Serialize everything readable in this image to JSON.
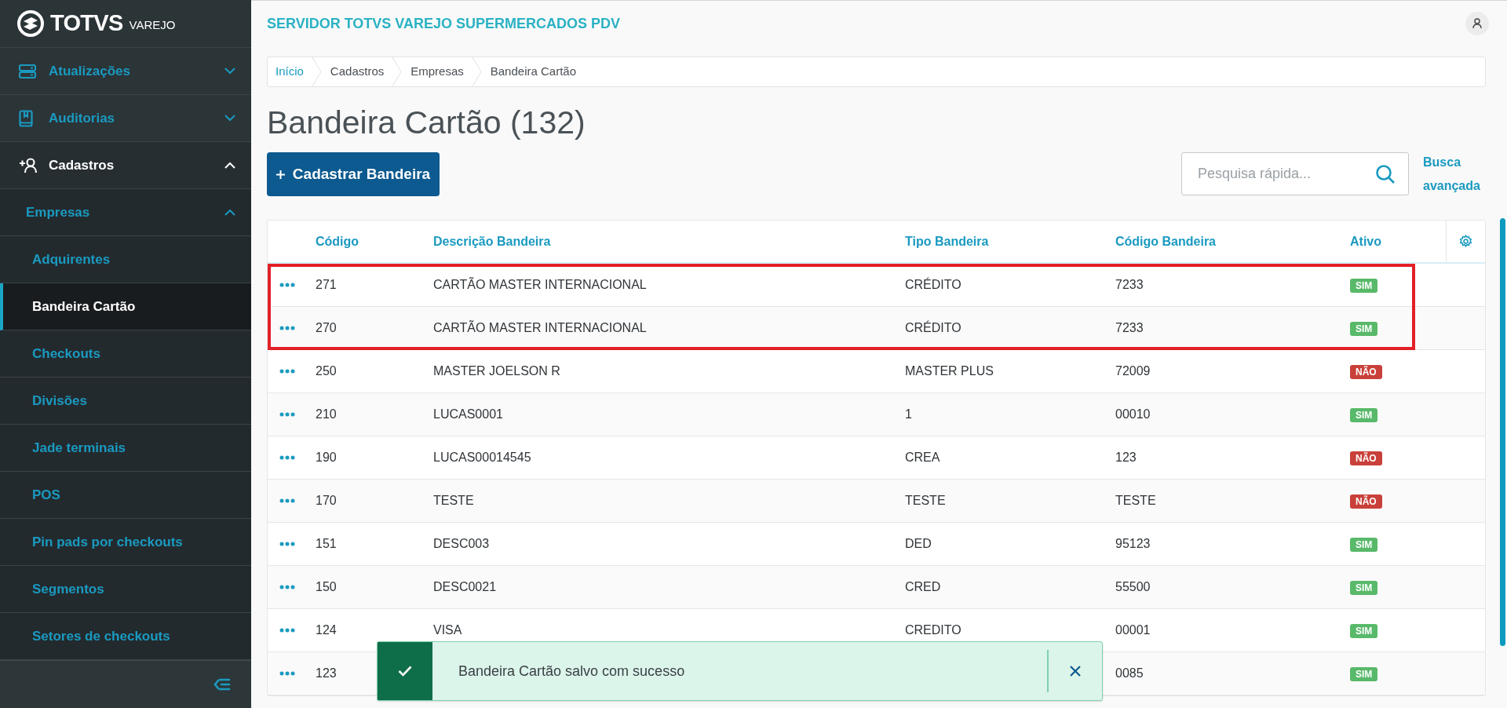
{
  "app": {
    "logo": "TOTVS",
    "logo_sub": "VAREJO",
    "server": "SERVIDOR TOTVS VAREJO SUPERMERCADOS PDV"
  },
  "sidebar": {
    "items": [
      {
        "label": "Atualizações",
        "expanded": false
      },
      {
        "label": "Auditorias",
        "expanded": false
      },
      {
        "label": "Cadastros",
        "expanded": true,
        "children": [
          {
            "label": "Empresas",
            "expanded": true,
            "children": [
              {
                "label": "Adquirentes",
                "selected": false
              },
              {
                "label": "Bandeira Cartão",
                "selected": true
              },
              {
                "label": "Checkouts",
                "selected": false
              },
              {
                "label": "Divisões",
                "selected": false
              },
              {
                "label": "Jade terminais",
                "selected": false
              },
              {
                "label": "POS",
                "selected": false
              },
              {
                "label": "Pin pads por checkouts",
                "selected": false
              },
              {
                "label": "Segmentos",
                "selected": false
              },
              {
                "label": "Setores de checkouts",
                "selected": false
              }
            ]
          }
        ]
      }
    ]
  },
  "breadcrumb": [
    "Início",
    "Cadastros",
    "Empresas",
    "Bandeira Cartão"
  ],
  "page_title": "Bandeira Cartão (132)",
  "add_button": "Cadastrar Bandeira",
  "search": {
    "placeholder": "Pesquisa rápida..."
  },
  "advanced_search": "Busca avançada",
  "table": {
    "columns": [
      "Código",
      "Descrição Bandeira",
      "Tipo Bandeira",
      "Código Bandeira",
      "Ativo"
    ],
    "rows": [
      {
        "code": "271",
        "description": "CARTÃO MASTER INTERNACIONAL",
        "type": "CRÉDITO",
        "flag_code": "7233",
        "status": "SIM",
        "active": true,
        "highlighted": true
      },
      {
        "code": "270",
        "description": "CARTÃO MASTER INTERNACIONAL",
        "type": "CRÉDITO",
        "flag_code": "7233",
        "status": "SIM",
        "active": true,
        "highlighted": true
      },
      {
        "code": "250",
        "description": "MASTER JOELSON R",
        "type": "MASTER PLUS",
        "flag_code": "72009",
        "status": "NÃO",
        "active": false,
        "highlighted": false
      },
      {
        "code": "210",
        "description": "LUCAS0001",
        "type": "1",
        "flag_code": "00010",
        "status": "SIM",
        "active": true,
        "highlighted": false
      },
      {
        "code": "190",
        "description": "LUCAS00014545",
        "type": "CREA",
        "flag_code": "123",
        "status": "NÃO",
        "active": false,
        "highlighted": false
      },
      {
        "code": "170",
        "description": "TESTE",
        "type": "TESTE",
        "flag_code": "TESTE",
        "status": "NÃO",
        "active": false,
        "highlighted": false
      },
      {
        "code": "151",
        "description": "DESC003",
        "type": "DED",
        "flag_code": "95123",
        "status": "SIM",
        "active": true,
        "highlighted": false
      },
      {
        "code": "150",
        "description": "DESC0021",
        "type": "CRED",
        "flag_code": "55500",
        "status": "SIM",
        "active": true,
        "highlighted": false
      },
      {
        "code": "124",
        "description": "VISA",
        "type": "CREDITO",
        "flag_code": "00001",
        "status": "SIM",
        "active": true,
        "highlighted": false
      },
      {
        "code": "123",
        "flag_code": "0085",
        "status": "SIM",
        "active": true,
        "highlighted": false
      }
    ]
  },
  "toast": {
    "kind": "success",
    "message": "Bandeira Cartão salvo com sucesso"
  }
}
